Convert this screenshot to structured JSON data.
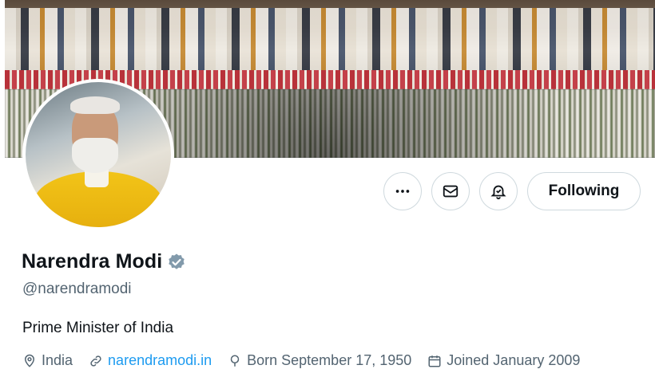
{
  "profile": {
    "name": "Narendra Modi",
    "handle": "@narendramodi",
    "bio": "Prime Minister of India",
    "verified_badge_color": "#829aab"
  },
  "actions": {
    "more_icon": "more-horizontal-icon",
    "message_icon": "envelope-icon",
    "notify_icon": "bell-check-icon",
    "follow_label": "Following"
  },
  "meta": {
    "location": "India",
    "website": "narendramodi.in",
    "birthdate": "Born September 17, 1950",
    "joined": "Joined January 2009"
  },
  "colors": {
    "text_primary": "#0f1419",
    "text_secondary": "#536471",
    "border": "#cfd9de"
  }
}
